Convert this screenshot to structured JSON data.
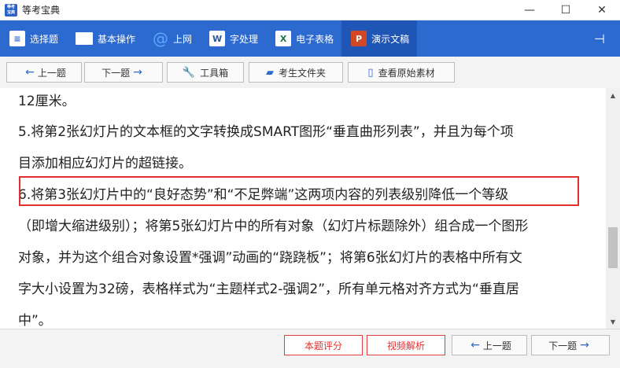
{
  "window": {
    "icon_text": "等考宝典",
    "title": "等考宝典",
    "minimize": "—",
    "maximize": "☐",
    "close": "✕"
  },
  "nav": {
    "items": [
      {
        "label": "选择题",
        "icon": "list-icon"
      },
      {
        "label": "基本操作",
        "icon": "window-icon"
      },
      {
        "label": "上网",
        "icon": "ie-icon",
        "glyph": "@"
      },
      {
        "label": "字处理",
        "icon": "word-icon",
        "glyph": "W"
      },
      {
        "label": "电子表格",
        "icon": "excel-icon",
        "glyph": "X"
      },
      {
        "label": "演示文稿",
        "icon": "ppt-icon",
        "glyph": "P",
        "active": true
      }
    ],
    "pin_glyph": "⊣"
  },
  "toolbar": {
    "prev_label": "上一题",
    "next_label": "下一题",
    "toolbox_label": "工具箱",
    "candidate_folder_label": "考生文件夹",
    "view_original_label": "查看原始素材"
  },
  "content": {
    "lines": [
      "12厘米。",
      "5.将第2张幻灯片的文本框的文字转换成SMART图形“垂直曲形列表”，并且为每个项",
      "目添加相应幻灯片的超链接。",
      "6.将第3张幻灯片中的“良好态势”和“不足弊端”这两项内容的列表级别降低一个等级",
      "（即增大缩进级别）；将第5张幻灯片中的所有对象（幻灯片标题除外）组合成一个图形",
      "对象，并为这个组合对象设置*强调”动画的“跷跷板”；将第6张幻灯片的表格中所有文",
      "字大小设置为32磅，表格样式为“主题样式2-强调2”，所有单元格对齐方式为“垂直居",
      "中”。"
    ]
  },
  "bottom": {
    "score_label": "本题评分",
    "video_label": "视频解析",
    "prev_label": "上一题",
    "next_label": "下一题"
  },
  "colors": {
    "nav_bg": "#2d6ad0",
    "highlight_border": "#e03030"
  }
}
